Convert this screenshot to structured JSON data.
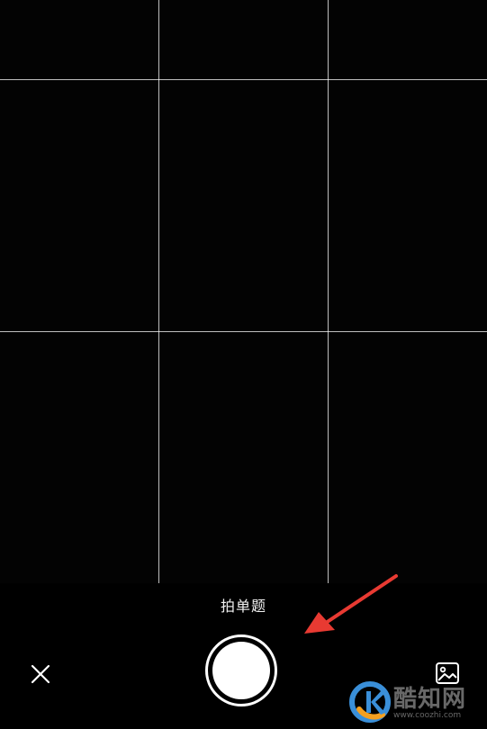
{
  "camera": {
    "mode_label": "拍单题"
  },
  "icons": {
    "close": "close-icon",
    "gallery": "image-gallery-icon",
    "shutter": "shutter-icon"
  },
  "annotation": {
    "arrow_color": "#e83a32"
  },
  "watermark": {
    "text": "酷知网",
    "url": "www.coozhi.com"
  }
}
